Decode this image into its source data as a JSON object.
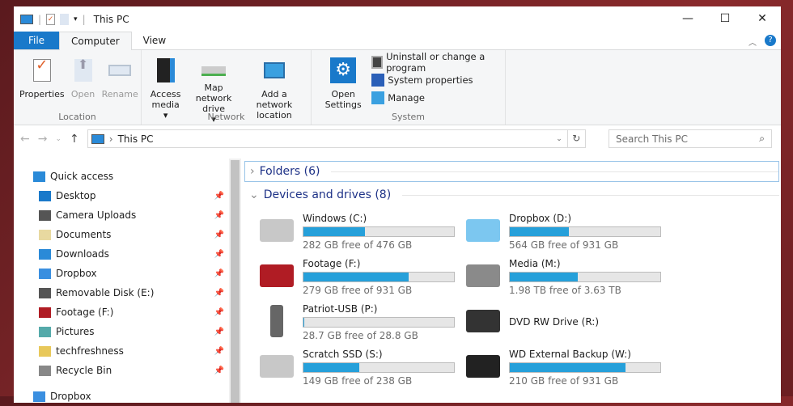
{
  "window": {
    "title": "This PC",
    "minimize": "—",
    "maximize": "☐",
    "close": "✕"
  },
  "tabs": {
    "file": "File",
    "computer": "Computer",
    "view": "View"
  },
  "ribbon": {
    "location": {
      "label": "Location",
      "properties": "Properties",
      "open": "Open",
      "rename": "Rename"
    },
    "network": {
      "label": "Network",
      "access_media": "Access media",
      "map_drive": "Map network drive",
      "add_location": "Add a network location"
    },
    "system": {
      "label": "System",
      "open_settings": "Open Settings",
      "uninstall": "Uninstall or change a program",
      "sys_props": "System properties",
      "manage": "Manage"
    }
  },
  "address": {
    "path": "This PC",
    "search_placeholder": "Search This PC"
  },
  "sidebar": {
    "items": [
      {
        "label": "Quick access",
        "top": true
      },
      {
        "label": "Desktop",
        "pin": true
      },
      {
        "label": "Camera Uploads",
        "pin": true
      },
      {
        "label": "Documents",
        "pin": true
      },
      {
        "label": "Downloads",
        "pin": true
      },
      {
        "label": "Dropbox",
        "pin": true
      },
      {
        "label": "Removable Disk (E:)",
        "pin": true
      },
      {
        "label": "Footage (F:)",
        "pin": true
      },
      {
        "label": "Pictures",
        "pin": true
      },
      {
        "label": "techfreshness",
        "pin": true
      },
      {
        "label": "Recycle Bin",
        "pin": true
      },
      {
        "label": "Dropbox",
        "top": true
      }
    ]
  },
  "content": {
    "folders": "Folders (6)",
    "devices": "Devices and drives (8)",
    "drives": [
      {
        "name": "Windows (C:)",
        "free": "282 GB free of 476 GB",
        "used": 0.41,
        "icon": "windows-drive-icon",
        "color": "#c8c8c8"
      },
      {
        "name": "Dropbox (D:)",
        "free": "564 GB free of 931 GB",
        "used": 0.39,
        "icon": "dropbox-folder-icon",
        "color": "#7cc7f0"
      },
      {
        "name": "Footage (F:)",
        "free": "279 GB free of 931 GB",
        "used": 0.7,
        "icon": "film-drive-icon",
        "color": "#b01c24"
      },
      {
        "name": "Media (M:)",
        "free": "1.98 TB free of 3.63 TB",
        "used": 0.45,
        "icon": "media-folder-icon",
        "color": "#8a8a8a"
      },
      {
        "name": "Patriot-USB (P:)",
        "free": "28.7 GB free of 28.8 GB",
        "used": 0.004,
        "icon": "usb-drive-icon",
        "color": "#666666"
      },
      {
        "name": "DVD RW Drive (R:)",
        "free": null,
        "used": null,
        "icon": "dvd-drive-icon",
        "color": "#333333"
      },
      {
        "name": "Scratch SSD (S:)",
        "free": "149 GB free of 238 GB",
        "used": 0.37,
        "icon": "hard-drive-icon",
        "color": "#c8c8c8"
      },
      {
        "name": "WD External Backup (W:)",
        "free": "210 GB free of 931 GB",
        "used": 0.77,
        "icon": "external-drive-icon",
        "color": "#222222"
      }
    ]
  }
}
